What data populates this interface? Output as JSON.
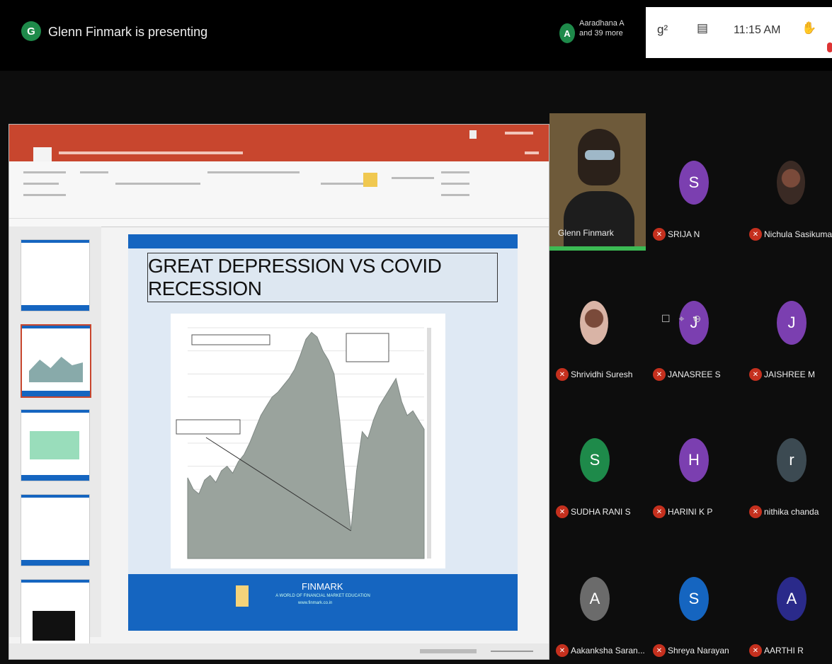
{
  "presenter": {
    "avatar_letter": "G",
    "text": "Glenn Finmark is presenting"
  },
  "participants_summary": {
    "avatar_letter": "A",
    "line1": "Aaradhana A",
    "line2": "and 39 more"
  },
  "status_bar": {
    "icon1": "g²",
    "icon2": "▤",
    "time": "11:15 AM",
    "icon3": "✋"
  },
  "slide": {
    "title": "GREAT DEPRESSION VS COVID RECESSION",
    "footer_name": "FINMARK",
    "footer_sub": "A WORLD OF FINANCIAL MARKET EDUCATION",
    "footer_web": "www.finmark.co.in"
  },
  "chart_data": {
    "type": "area",
    "title": "",
    "xlabel": "",
    "ylabel": "",
    "series": [
      {
        "values": [
          35,
          30,
          28,
          34,
          36,
          33,
          38,
          40,
          37,
          42,
          45,
          50,
          56,
          62,
          66,
          70,
          72,
          75,
          78,
          82,
          88,
          95,
          98,
          96,
          90,
          86,
          80,
          60,
          35,
          12,
          38,
          55,
          52,
          60,
          66,
          70,
          74,
          78,
          68,
          62,
          64,
          60,
          56
        ]
      }
    ]
  },
  "tiles": [
    {
      "name": "Glenn Finmark",
      "type": "video",
      "color": ""
    },
    {
      "name": "SRIJA N",
      "letter": "S",
      "color": "#7b3fb0"
    },
    {
      "name": "Nichula Sasikumar",
      "letter": "",
      "color": "#3a2a24"
    },
    {
      "name": "Shrividhi Suresh",
      "letter": "",
      "color": "#d9b4a6"
    },
    {
      "name": "JANASREE S",
      "letter": "J",
      "color": "#7b3fb0"
    },
    {
      "name": "JAISHREE M",
      "letter": "J",
      "color": "#7b3fb0"
    },
    {
      "name": "SUDHA RANI S",
      "letter": "S",
      "color": "#1e8a4a"
    },
    {
      "name": "HARINI K P",
      "letter": "H",
      "color": "#7b3fb0"
    },
    {
      "name": "nithika chanda",
      "letter": "r",
      "color": "#3c4a52"
    },
    {
      "name": "Aakanksha Saran...",
      "letter": "A",
      "color": "#6b6b6b"
    },
    {
      "name": "Shreya Narayan",
      "letter": "S",
      "color": "#1565c0"
    },
    {
      "name": "AARTHI R",
      "letter": "A",
      "color": "#2a2a8a"
    }
  ]
}
